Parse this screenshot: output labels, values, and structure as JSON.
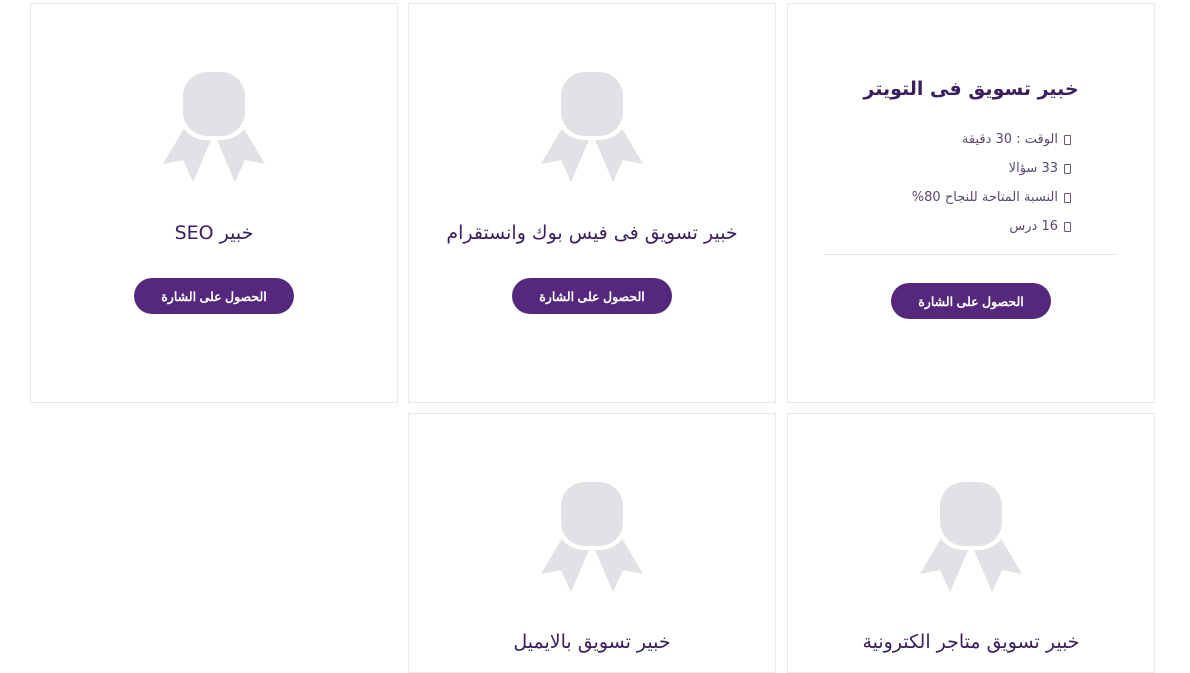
{
  "colors": {
    "accent": "#55287d",
    "title": "#3a1e5e",
    "badge": "#e1e2e5",
    "border": "#e9e9ec"
  },
  "cards": [
    {
      "title": "خبير تسويق فى التويتر",
      "details": [
        "الوقت : 30 دقيقة",
        "33 سؤالا",
        "النسبة المتاحة للنجاح 80%",
        "16 درس"
      ],
      "button_label": "الحصول على الشارة",
      "icon": "ribbon-badge-icon"
    },
    {
      "title": "خبير تسويق فى فيس بوك وانستقرام",
      "button_label": "الحصول على الشارة",
      "icon": "ribbon-badge-icon"
    },
    {
      "title": "خبير SEO",
      "button_label": "الحصول على الشارة",
      "icon": "ribbon-badge-icon"
    },
    {
      "title": "خبير تسويق متاجر الكترونية",
      "icon": "ribbon-badge-icon"
    },
    {
      "title": "خبير تسويق بالايميل",
      "icon": "ribbon-badge-icon"
    }
  ]
}
